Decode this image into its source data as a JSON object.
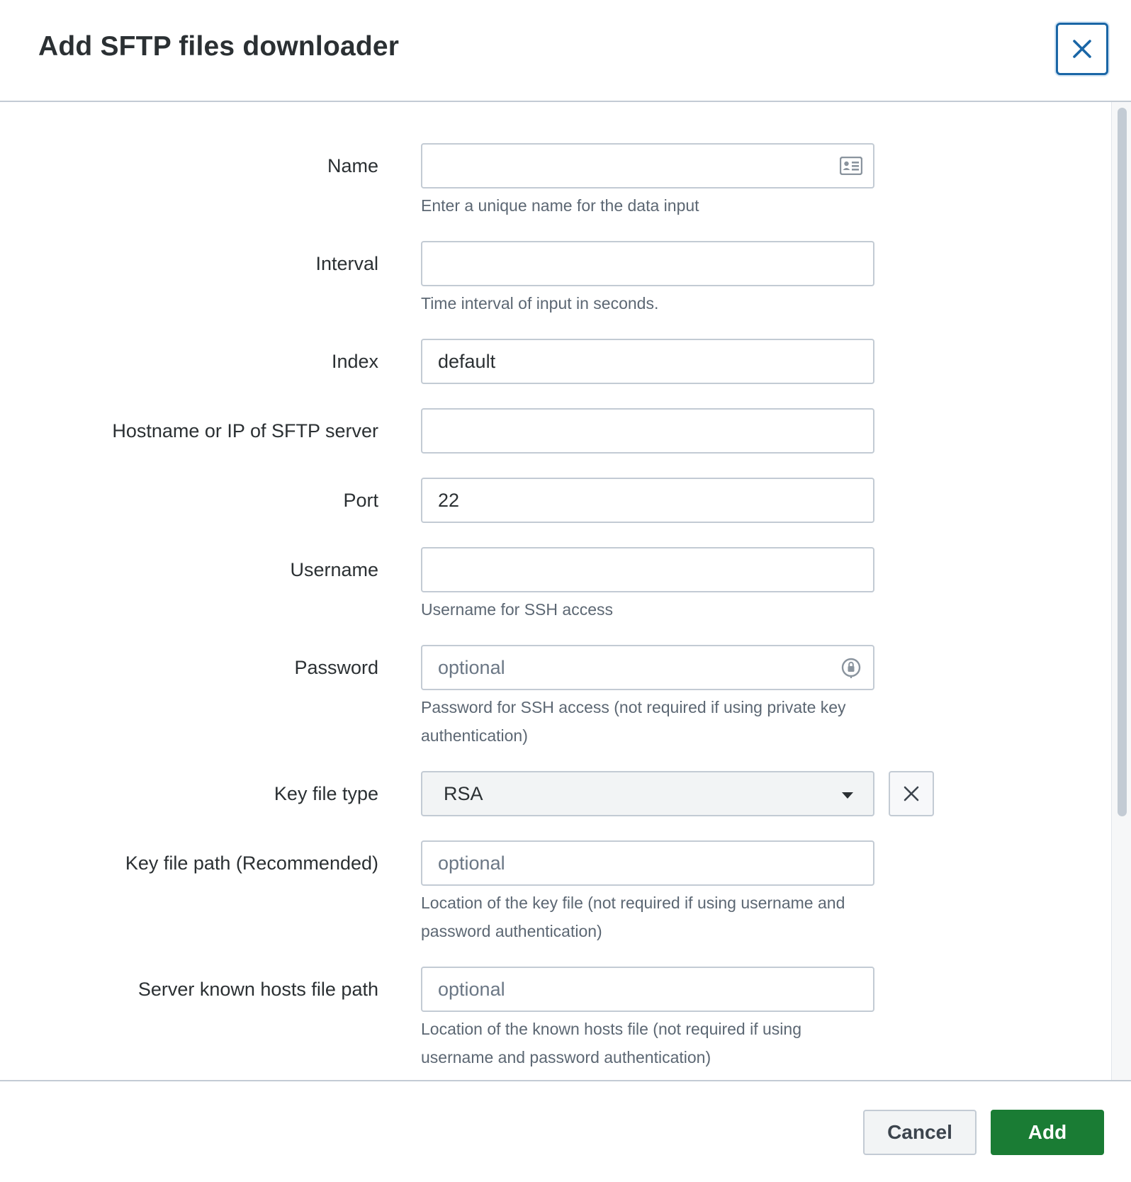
{
  "dialog": {
    "title": "Add SFTP files downloader",
    "close_icon": "close-icon"
  },
  "form": {
    "name": {
      "label": "Name",
      "value": "",
      "help": "Enter a unique name for the data input",
      "icon": "contact-card-icon"
    },
    "interval": {
      "label": "Interval",
      "value": "",
      "help": "Time interval of input in seconds."
    },
    "index": {
      "label": "Index",
      "value": "default"
    },
    "hostname": {
      "label": "Hostname or IP of SFTP server",
      "value": ""
    },
    "port": {
      "label": "Port",
      "value": "22"
    },
    "username": {
      "label": "Username",
      "value": "",
      "help": "Username for SSH access"
    },
    "password": {
      "label": "Password",
      "placeholder": "optional",
      "help_line1": "Password for SSH access (not required if using private key",
      "help_line2": "authentication)",
      "icon": "password-manager-icon"
    },
    "key_file_type": {
      "label": "Key file type",
      "selected": "RSA",
      "icon": "chevron-down-icon",
      "clear_icon": "close-icon"
    },
    "key_file_path": {
      "label": "Key file path (Recommended)",
      "placeholder": "optional",
      "help_line1": "Location of the key file (not required if using username and",
      "help_line2": "password authentication)"
    },
    "known_hosts": {
      "label": "Server known hosts file path",
      "placeholder": "optional",
      "help_line1": "Location of the known hosts file (not required if using",
      "help_line2": "username and password authentication)"
    }
  },
  "footer": {
    "cancel_label": "Cancel",
    "add_label": "Add"
  },
  "colors": {
    "accent_blue": "#1a66a6",
    "add_green": "#1a7c34",
    "border": "#c3cbd4",
    "text": "#2b3033",
    "help_text": "#5c6773"
  }
}
